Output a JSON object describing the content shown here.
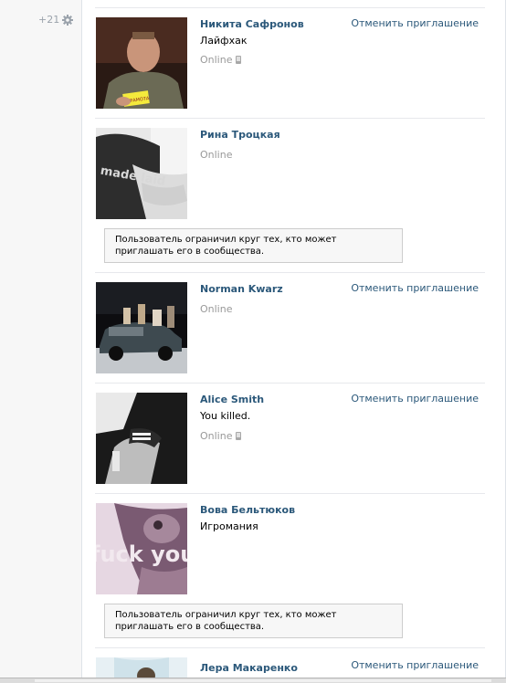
{
  "counter": {
    "text": "+21",
    "icon": "gear-icon"
  },
  "cancel_label": "Отменить приглашение",
  "restriction_text": "Пользователь ограничил круг тех, кто может приглашать его в сообщества.",
  "friends": [
    {
      "name": "Никита Сафронов",
      "status": "Лайфхак",
      "online": "Online",
      "mobile": true,
      "cancel": true
    },
    {
      "name": "Рина Троцкая",
      "status": "",
      "online": "Online",
      "mobile": false,
      "cancel": false,
      "restricted": true
    },
    {
      "name": "Norman Kwarz",
      "status": "",
      "online": "Online",
      "mobile": false,
      "cancel": true
    },
    {
      "name": "Alice Smith",
      "status": "You killed.",
      "online": "Online",
      "mobile": true,
      "cancel": true
    },
    {
      "name": "Вова Бельтюков",
      "status": "Игромания",
      "online": "",
      "mobile": false,
      "cancel": false,
      "restricted": true
    },
    {
      "name": "Лера Макаренко",
      "status": "",
      "online": "",
      "mobile": false,
      "cancel": true
    }
  ],
  "photo_texts": {
    "certificate": "ГРАМОТА",
    "shirt": "made laid",
    "wallpaper": "fuck you"
  }
}
